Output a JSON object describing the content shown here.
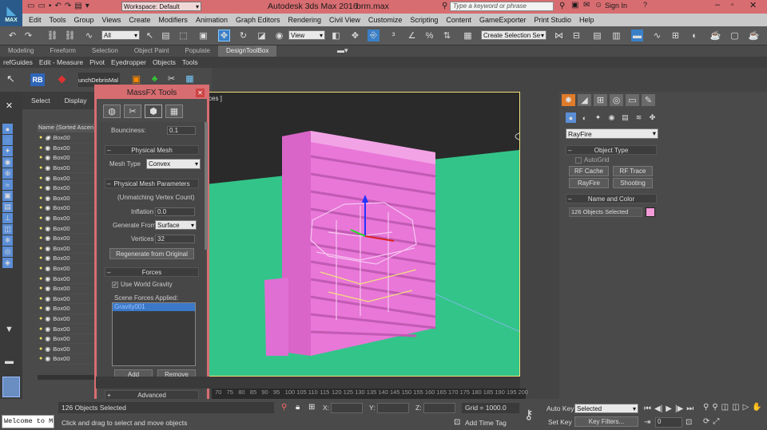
{
  "titlebar": {
    "workspace": "Workspace: Default",
    "app_title": "Autodesk 3ds Max 2016",
    "file": "brm.max",
    "search_placeholder": "Type a keyword or phrase",
    "sign_in": "Sign In"
  },
  "logo": {
    "label": "MAX"
  },
  "menu": [
    "Edit",
    "Tools",
    "Group",
    "Views",
    "Create",
    "Modifiers",
    "Animation",
    "Graph Editors",
    "Rendering",
    "Civil View",
    "Customize",
    "Scripting",
    "Content",
    "GameExporter",
    "Print Studio",
    "Help"
  ],
  "maintoolbar": {
    "filter": "All",
    "view": "View",
    "selection_set": "Create Selection Se"
  },
  "ribbon_tabs": [
    "Modeling",
    "Freeform",
    "Selection",
    "Object Paint",
    "Populate",
    "DesignToolBox"
  ],
  "ribbon_active": "DesignToolBox",
  "tools_bar": [
    "refGuides",
    "Edit - Measure",
    "Pivot",
    "Eyedropper",
    "Objects",
    "Tools"
  ],
  "iconbar": {
    "rb_label": "RB",
    "debris_label": "unchDebrisMal"
  },
  "scene_explorer": {
    "tabs": [
      "Select",
      "Display"
    ],
    "header": "Name (Sorted Ascen",
    "items": [
      "Box00",
      "Box00",
      "Box00",
      "Box00",
      "Box00",
      "Box00",
      "Box00",
      "Box00",
      "Box00",
      "Box00",
      "Box00",
      "Box00",
      "Box00",
      "Box00",
      "Box00",
      "Box00",
      "Box00",
      "Box00",
      "Box00",
      "Box00",
      "Box00",
      "Box00",
      "Box00"
    ]
  },
  "viewport": {
    "label": "ces ]"
  },
  "massfx": {
    "title": "MassFX Tools",
    "bounciness_label": "Bounciness:",
    "bounciness_value": "0.1",
    "physical_mesh_header": "Physical Mesh",
    "mesh_type_label": "Mesh Type",
    "mesh_type_value": "Convex",
    "mesh_params_header": "Physical Mesh Parameters",
    "unmatching": "(Unmatching Vertex Count)",
    "inflation_label": "Inflation",
    "inflation_value": "0.0",
    "generate_from_label": "Generate From",
    "generate_from_value": "Surface",
    "vertices_label": "Vertices",
    "vertices_value": "32",
    "regenerate_button": "Regenerate from Original",
    "forces_header": "Forces",
    "world_gravity_label": "Use World Gravity",
    "scene_forces_label": "Scene Forces Applied:",
    "force_item": "Gravity001",
    "add_button": "Add",
    "remove_button": "Remove",
    "advanced_header": "Advanced"
  },
  "timeline": {
    "ticks": [
      "70",
      "75",
      "80",
      "85",
      "90",
      "95",
      "100",
      "105",
      "110",
      "115",
      "120",
      "125",
      "130",
      "135",
      "140",
      "145",
      "150",
      "155",
      "160",
      "165",
      "170",
      "175",
      "180",
      "185",
      "190",
      "195",
      "200"
    ]
  },
  "status": {
    "maxscript": "Welcome to M",
    "objects_selected": "126 Objects Selected",
    "prompt": "Click and drag to select and move objects",
    "x_label": "X:",
    "y_label": "Y:",
    "z_label": "Z:",
    "grid": "Grid = 1000.0",
    "add_time_tag": "Add Time Tag",
    "auto_key": "Auto Key",
    "set_key": "Set Key",
    "selected_dd": "Selected",
    "key_filters": "Key Filters...",
    "frame": "0"
  },
  "command_panel": {
    "category": "RayFire",
    "object_type_header": "Object Type",
    "autogrid": "AutoGrid",
    "buttons": [
      "RF Cache",
      "RF Trace",
      "RayFire",
      "Shooting"
    ],
    "name_color_header": "Name and Color",
    "name_value": "126 Objects Selected",
    "swatch_color": "#f39bd7"
  },
  "colors": {
    "titlebar": "#d86d71",
    "ground": "#33c489",
    "building": "#e877d8",
    "viewport_border": "#f3e07a"
  }
}
